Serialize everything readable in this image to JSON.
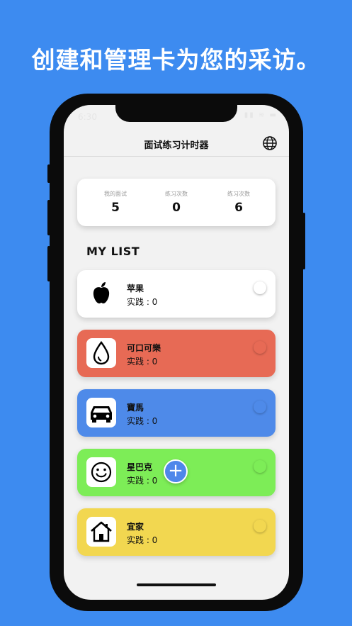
{
  "headline": "创建和管理卡为您的采访。",
  "status_bar": {
    "time": "6:30",
    "icons": "▮▮ ≋ ▬"
  },
  "navbar": {
    "title": "面试练习计时器",
    "globe_icon": "globe-icon"
  },
  "stats": [
    {
      "label": "我的面试",
      "value": "5"
    },
    {
      "label": "练习次数",
      "value": "0"
    },
    {
      "label": "练习次数",
      "value": "6"
    }
  ],
  "list_title": "MY LIST",
  "cards": [
    {
      "name": "苹果",
      "sub": "实践 : 0",
      "color": "#ffffff",
      "icon": "apple-icon"
    },
    {
      "name": "可口可樂",
      "sub": "实践 : 0",
      "color": "#e76a55",
      "icon": "drop-icon"
    },
    {
      "name": "寶馬",
      "sub": "实践 : 0",
      "color": "#4e8ae9",
      "icon": "car-icon"
    },
    {
      "name": "星巴克",
      "sub": "实践 : 0",
      "color": "#7ded57",
      "icon": "smiley-icon"
    },
    {
      "name": " 宜家",
      "sub": "实践 : 0",
      "color": "#f2d750",
      "icon": "house-icon"
    }
  ],
  "fab": {
    "label": "+"
  }
}
